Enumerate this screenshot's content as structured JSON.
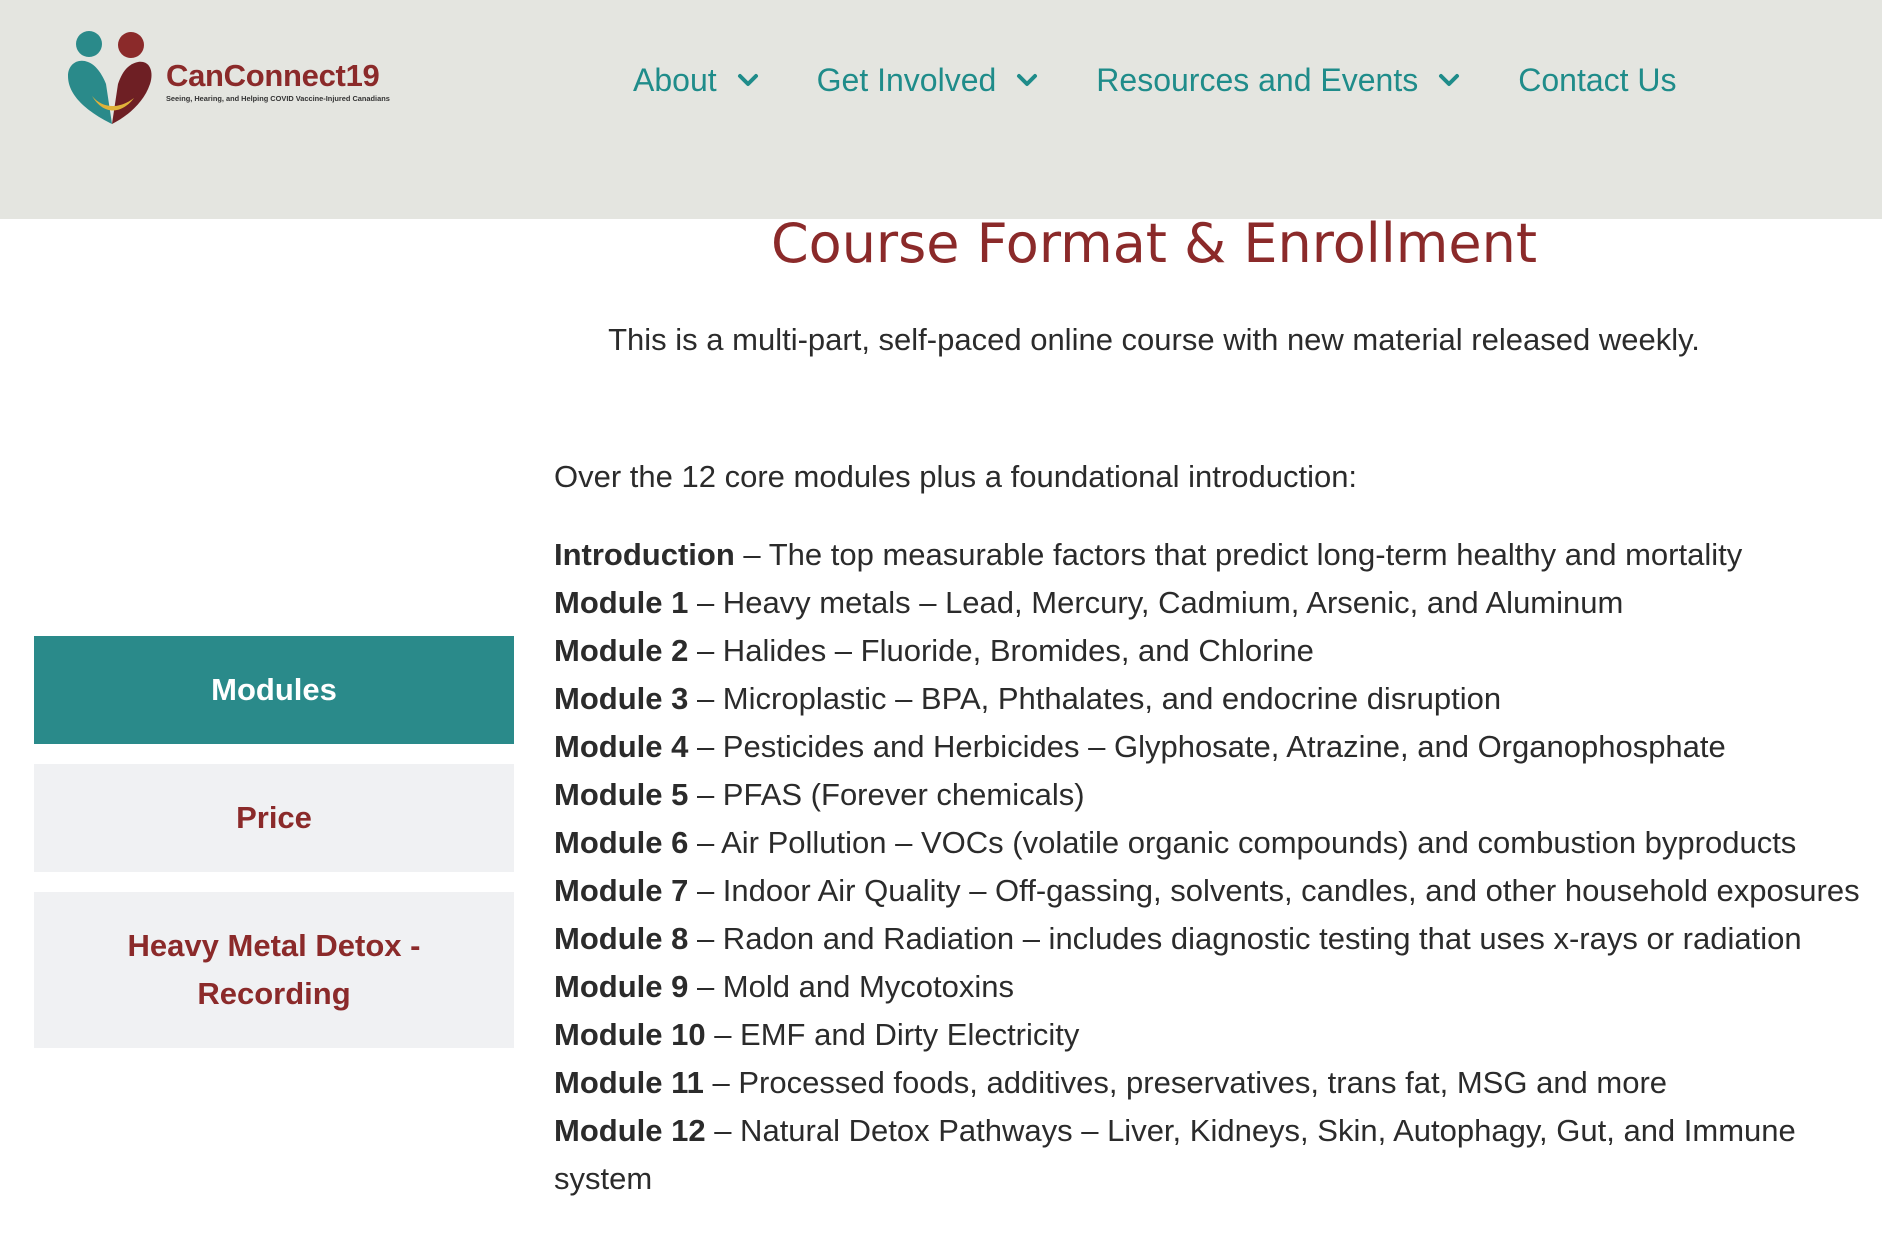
{
  "header": {
    "logo": {
      "title": "CanConnect19",
      "tagline": "Seeing, Hearing, and Helping COVID Vaccine-Injured Canadians"
    },
    "nav": [
      {
        "label": "About",
        "has_dropdown": true
      },
      {
        "label": "Get Involved",
        "has_dropdown": true
      },
      {
        "label": "Resources and Events",
        "has_dropdown": true
      },
      {
        "label": "Contact Us",
        "has_dropdown": false
      }
    ]
  },
  "main": {
    "title": "Course Format & Enrollment",
    "intro": "This is a multi-part, self-paced online course with new material released weekly.",
    "over_text": "Over the 12 core modules plus a foundational introduction:",
    "modules": [
      {
        "name": "Introduction",
        "desc": " – The top measurable factors that predict long-term healthy and mortality"
      },
      {
        "name": "Module 1",
        "desc": " – Heavy metals – Lead, Mercury, Cadmium, Arsenic, and Aluminum"
      },
      {
        "name": "Module 2",
        "desc": " – Halides – Fluoride, Bromides, and Chlorine"
      },
      {
        "name": "Module 3",
        "desc": " – Microplastic – BPA, Phthalates, and endocrine disruption"
      },
      {
        "name": "Module 4",
        "desc": " – Pesticides and Herbicides – Glyphosate, Atrazine, and Organophosphate"
      },
      {
        "name": "Module 5",
        "desc": " – PFAS (Forever chemicals)"
      },
      {
        "name": "Module 6",
        "desc": " – Air Pollution – VOCs (volatile organic compounds) and combustion byproducts"
      },
      {
        "name": "Module 7",
        "desc": " – Indoor Air Quality – Off-gassing, solvents, candles, and other household exposures"
      },
      {
        "name": "Module 8",
        "desc": " – Radon and Radiation – includes diagnostic testing that uses x-rays or radiation"
      },
      {
        "name": "Module 9",
        "desc": " – Mold and Mycotoxins"
      },
      {
        "name": "Module 10",
        "desc": " – EMF and Dirty Electricity"
      },
      {
        "name": "Module 11",
        "desc": " – Processed foods, additives, preservatives, trans fat, MSG and more"
      },
      {
        "name": "Module 12",
        "desc": " – Natural Detox Pathways – Liver, Kidneys, Skin, Autophagy, Gut, and Immune system"
      }
    ]
  },
  "sidebar": {
    "tabs": [
      {
        "label": "Modules",
        "active": true
      },
      {
        "label": "Price",
        "active": false
      },
      {
        "label": "Heavy Metal Detox - Recording",
        "active": false
      }
    ]
  },
  "colors": {
    "teal": "#1f8c8a",
    "active_tab": "#2a8a8a",
    "maroon": "#8b2a2a",
    "header_bg": "#e4e5e0",
    "tab_bg": "#f0f1f3"
  }
}
